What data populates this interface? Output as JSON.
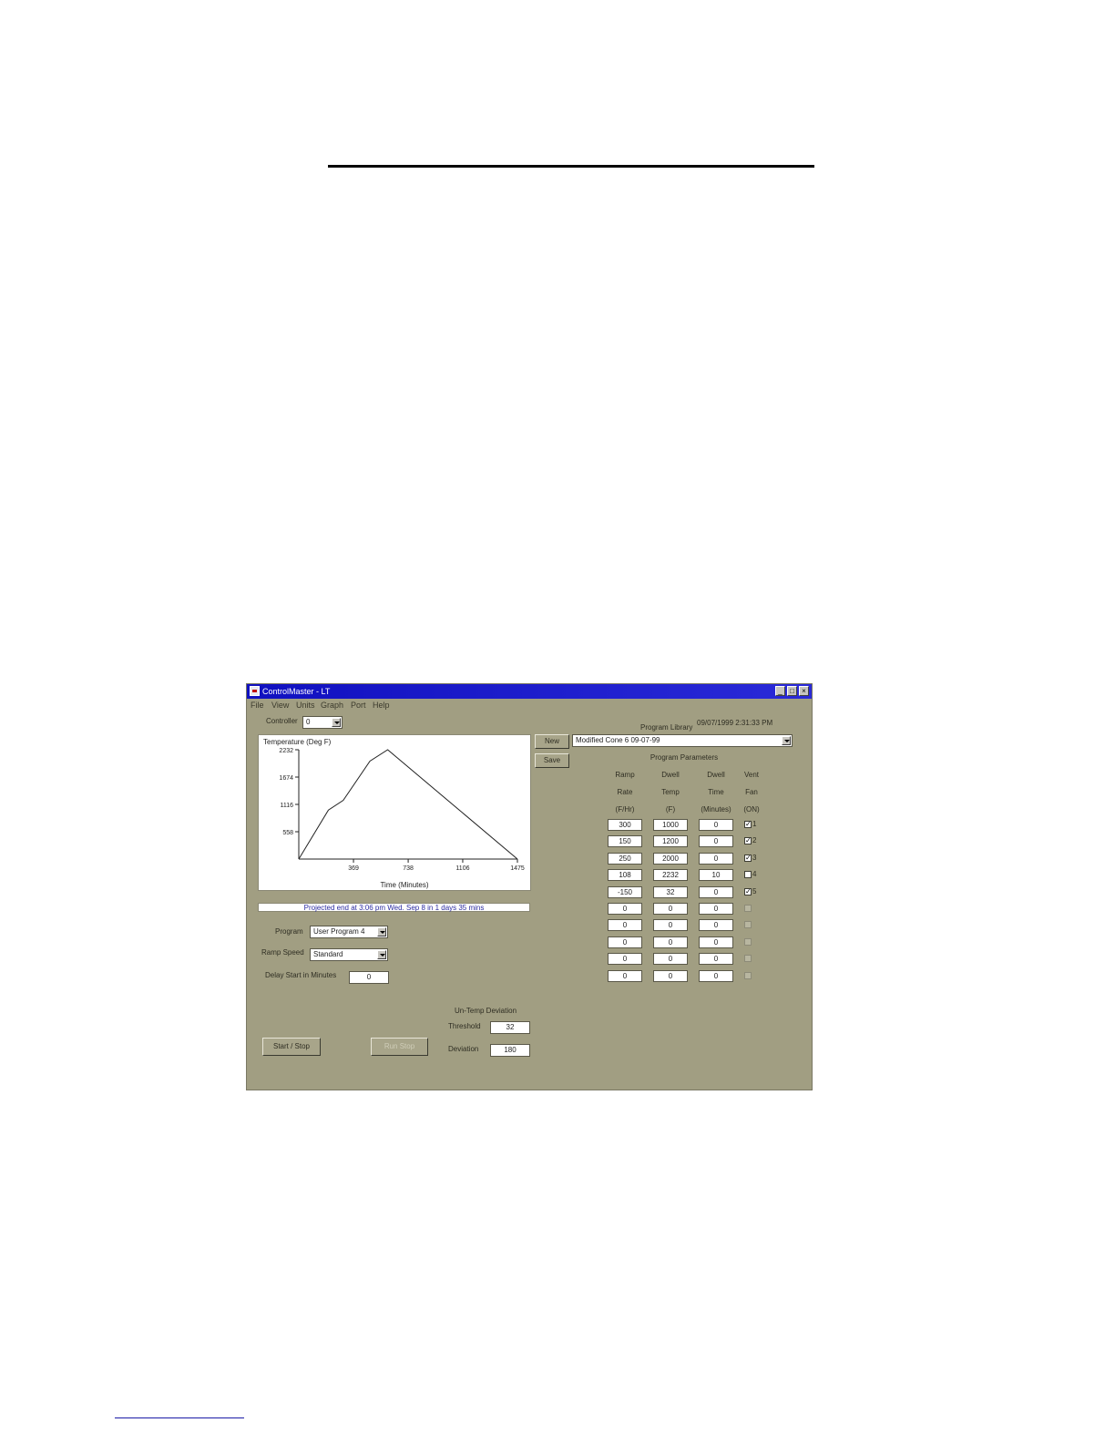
{
  "window": {
    "title": "ControlMaster - LT",
    "btn_min": "_",
    "btn_max": "□",
    "btn_close": "×",
    "datetime": "09/07/1999 2:31:33 PM"
  },
  "menu": [
    "File",
    "View",
    "Units",
    "Graph",
    "Port",
    "Help"
  ],
  "controller": {
    "label": "Controller",
    "value": "0"
  },
  "library": {
    "label": "Program Library",
    "new_button": "New",
    "save_button": "Save",
    "selected": "Modified Cone 6 09-07-99"
  },
  "chart_data": {
    "type": "line",
    "title": "Temperature (Deg F)",
    "xlabel": "Time (Minutes)",
    "ylabel": "Temperature (Deg F)",
    "xlim": [
      0,
      1475
    ],
    "ylim": [
      0,
      2232
    ],
    "x_ticks": [
      369,
      738,
      1106,
      1475
    ],
    "y_ticks": [
      558,
      1116,
      1674,
      2232
    ],
    "series": [
      {
        "x": [
          0,
          200,
          300,
          480,
          600,
          1475
        ],
        "y": [
          0,
          1000,
          1200,
          2000,
          2232,
          0
        ]
      }
    ]
  },
  "status_text": "Projected end at 3:06 pm Wed. Sep 8 in 1 days 35 mins",
  "program": {
    "label": "Program",
    "value": "User Program 4"
  },
  "ramp_speed": {
    "label": "Ramp Speed",
    "value": "Standard"
  },
  "delay_start": {
    "label": "Delay Start in Minutes",
    "value": "0"
  },
  "deviation": {
    "title": "Un-Temp Deviation",
    "threshold_label": "Threshold",
    "threshold_value": "32",
    "deviation_label": "Deviation",
    "deviation_value": "180"
  },
  "buttons": {
    "start_stop": "Start / Stop",
    "run_stop": "Run Stop"
  },
  "params": {
    "title": "Program Parameters",
    "col_ramp": [
      "Ramp",
      "Rate",
      "(F/Hr)"
    ],
    "col_dtemp": [
      "Dwell",
      "Temp",
      "(F)"
    ],
    "col_dtime": [
      "Dwell",
      "Time",
      "(Minutes)"
    ],
    "col_vent": [
      "Vent",
      "Fan",
      "(ON)"
    ],
    "rows": [
      {
        "rate": "300",
        "temp": "1000",
        "time": "0",
        "vent": "✓",
        "seg": "1",
        "enabled": true
      },
      {
        "rate": "150",
        "temp": "1200",
        "time": "0",
        "vent": "✓",
        "seg": "2",
        "enabled": true
      },
      {
        "rate": "250",
        "temp": "2000",
        "time": "0",
        "vent": "✓",
        "seg": "3",
        "enabled": true
      },
      {
        "rate": "108",
        "temp": "2232",
        "time": "10",
        "vent": "",
        "seg": "4",
        "enabled": true
      },
      {
        "rate": "-150",
        "temp": "32",
        "time": "0",
        "vent": "✓",
        "seg": "5",
        "enabled": true
      },
      {
        "rate": "0",
        "temp": "0",
        "time": "0",
        "vent": "",
        "seg": "",
        "enabled": false
      },
      {
        "rate": "0",
        "temp": "0",
        "time": "0",
        "vent": "",
        "seg": "",
        "enabled": false
      },
      {
        "rate": "0",
        "temp": "0",
        "time": "0",
        "vent": "",
        "seg": "",
        "enabled": false
      },
      {
        "rate": "0",
        "temp": "0",
        "time": "0",
        "vent": "",
        "seg": "",
        "enabled": false
      },
      {
        "rate": "0",
        "temp": "0",
        "time": "0",
        "vent": "",
        "seg": "",
        "enabled": false
      }
    ]
  }
}
